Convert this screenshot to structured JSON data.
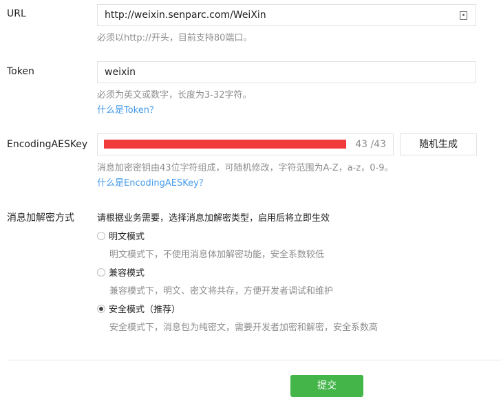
{
  "url": {
    "label": "URL",
    "value": "http://weixin.senparc.com/WeiXin",
    "hint": "必须以http://开头，目前支持80端口。"
  },
  "token": {
    "label": "Token",
    "value": "weixin",
    "hint": "必须为英文或数字，长度为3-32字符。",
    "help_link": "什么是Token？"
  },
  "aes_key": {
    "label": "EncodingAESKey",
    "counter": "43 /43",
    "random_button": "随机生成",
    "hint": "消息加密密钥由43位字符组成，可随机修改，字符范围为A-Z，a-z，0-9。",
    "help_link": "什么是EncodingAESKey？"
  },
  "encryption": {
    "label": "消息加解密方式",
    "intro": "请根据业务需要，选择消息加解密类型，启用后将立即生效",
    "options": [
      {
        "label": "明文模式",
        "desc": "明文模式下，不使用消息体加解密功能，安全系数较低",
        "checked": false
      },
      {
        "label": "兼容模式",
        "desc": "兼容模式下，明文、密文将共存，方便开发者调试和维护",
        "checked": false
      },
      {
        "label": "安全模式（推荐）",
        "desc": "安全模式下，消息包为纯密文，需要开发者加密和解密，安全系数高",
        "checked": true
      }
    ]
  },
  "submit_label": "提交",
  "colors": {
    "accent": "#44b549",
    "link": "#459ae9",
    "hint": "#8d8d8d",
    "redaction": "#f13b3b"
  }
}
